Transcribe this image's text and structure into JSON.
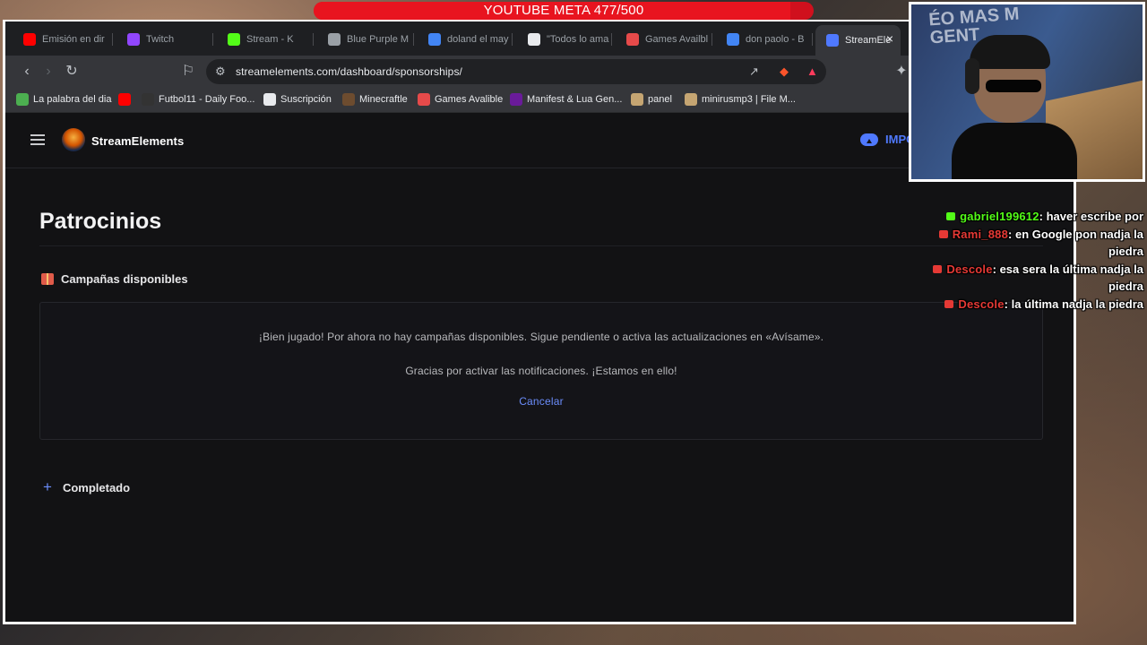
{
  "goal": {
    "text": "YOUTUBE META 477/500",
    "current": 477,
    "target": 500
  },
  "tabs": [
    {
      "label": "Emisión en dir",
      "icon": "youtube-icon",
      "color": "#ff0000"
    },
    {
      "label": "Twitch",
      "icon": "twitch-icon",
      "color": "#9146ff"
    },
    {
      "label": "Stream - K",
      "icon": "kick-icon",
      "color": "#53fc18"
    },
    {
      "label": "Blue Purple M",
      "icon": "globe-icon",
      "color": "#9aa0a6"
    },
    {
      "label": "doland el may",
      "icon": "google-icon",
      "color": "#4285f4"
    },
    {
      "label": "\"Todos lo ama",
      "icon": "news-icon",
      "color": "#e8eaed"
    },
    {
      "label": "Games Availbl",
      "icon": "games-icon",
      "color": "#e64a4a"
    },
    {
      "label": "don paolo - B",
      "icon": "google-icon",
      "color": "#4285f4"
    },
    {
      "label": "StreamEle",
      "icon": "streamelements-icon",
      "color": "#4f79ff",
      "active": true
    }
  ],
  "toolbar": {
    "url": "streamelements.com/dashboard/sponsorships/"
  },
  "bookmarks": [
    {
      "label": "La palabra del dia",
      "icon": "palabra-icon",
      "color": "#4caf50"
    },
    {
      "label": "",
      "icon": "youtube-icon",
      "color": "#ff0000"
    },
    {
      "label": "Futbol11 - Daily Foo...",
      "icon": "futbol-icon",
      "color": "#333333"
    },
    {
      "label": "Suscripción",
      "icon": "suscripcion-icon",
      "color": "#e8eaed"
    },
    {
      "label": "Minecraftle",
      "icon": "minecraft-icon",
      "color": "#6d4c2f"
    },
    {
      "label": "Games Avalible",
      "icon": "games-icon",
      "color": "#e64a4a"
    },
    {
      "label": "Manifest & Lua Gen...",
      "icon": "manifest-icon",
      "color": "#6a1b9a"
    },
    {
      "label": "panel",
      "icon": "folder-icon",
      "color": "#c5a572"
    },
    {
      "label": "minirusmp3 | File M...",
      "icon": "folder-icon",
      "color": "#c5a572"
    }
  ],
  "page": {
    "brand": "StreamElements",
    "upload_label": "IMPO",
    "title": "Patrocinios",
    "available_heading": "Campañas disponibles",
    "empty_message": "¡Bien jugado! Por ahora no hay campañas disponibles. Sigue pendiente o activa las actualizaciones en «Avísame».",
    "notify_message": "Gracias por activar las notificaciones. ¡Estamos en ello!",
    "cancel_label": "Cancelar",
    "completed_heading": "Completado",
    "completed_icon": "+"
  },
  "webcam": {
    "wall_text": "ÉO MAS M\nGENT"
  },
  "chat": [
    {
      "platform": "kick",
      "user": "gabriel199612",
      "user_color": "#53fc18",
      "text": ": haver escribe por"
    },
    {
      "platform": "youtube",
      "user": "Rami_888",
      "user_color": "#e53935",
      "text": ": en Google pon nadja la piedra"
    },
    {
      "platform": "youtube",
      "user": "Descole",
      "user_color": "#e53935",
      "text": ": esa sera la última nadja la piedra"
    },
    {
      "platform": "youtube",
      "user": "Descole",
      "user_color": "#e53935",
      "text": ": la última nadja la piedra"
    }
  ]
}
